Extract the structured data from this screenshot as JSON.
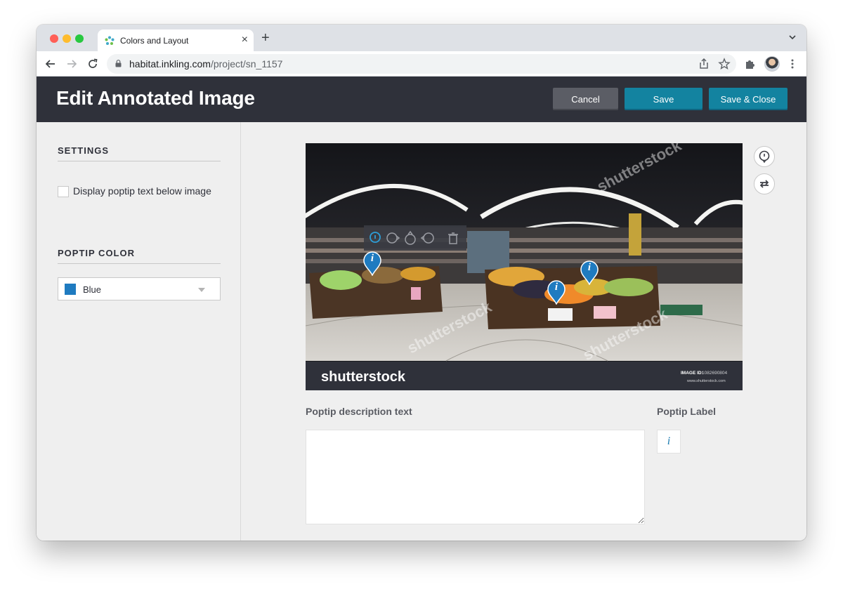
{
  "browser": {
    "tab_title": "Colors and Layout",
    "tab_close": "×",
    "new_tab": "+",
    "url_host": "habitat.inkling.com",
    "url_path": "/project/sn_1157"
  },
  "header": {
    "title": "Edit Annotated Image",
    "cancel_label": "Cancel",
    "save_label": "Save",
    "save_close_label": "Save & Close"
  },
  "sidebar": {
    "settings_title": "SETTINGS",
    "display_below_label": "Display poptip text below image",
    "display_below_checked": false,
    "poptip_color_title": "POPTIP COLOR",
    "poptip_color_value": "Blue",
    "poptip_color_hex": "#1f7bc0"
  },
  "image": {
    "watermark": "shutterstock",
    "banner_brand": "shutterstock",
    "image_id_label": "IMAGE ID:",
    "image_id": "1082690804",
    "banner_url": "www.shutterstock.com",
    "pin_label": "i"
  },
  "main": {
    "description_label": "Poptip description text",
    "label_label": "Poptip Label",
    "label_value": "i"
  },
  "colors": {
    "header_bg": "#2f313a",
    "primary": "#1383a0",
    "secondary": "#5b5d65",
    "pin": "#1f7bc0"
  }
}
